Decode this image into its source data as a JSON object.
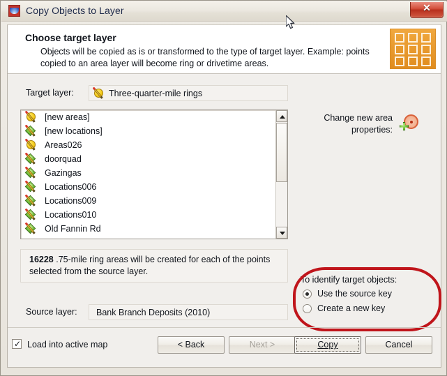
{
  "window": {
    "title": "Copy Objects to Layer",
    "app_icon": "app-window-icon",
    "close_label": "✕"
  },
  "header": {
    "title": "Choose target layer",
    "description": "Objects will be copied as is or transformed to the type of target layer. Example: points copied to an area layer will become ring or drivetime areas.",
    "icon": "grid-of-squares-icon"
  },
  "target": {
    "label": "Target layer:",
    "value": "Three-quarter-mile rings",
    "icon": "area-layer-icon"
  },
  "layer_list": {
    "items": [
      {
        "label": "[new areas]",
        "icon": "area-layer-icon"
      },
      {
        "label": "[new locations]",
        "icon": "point-layer-icon"
      },
      {
        "label": "Areas026",
        "icon": "area-layer-icon"
      },
      {
        "label": "doorquad",
        "icon": "point-layer-icon"
      },
      {
        "label": "Gazingas",
        "icon": "point-layer-icon"
      },
      {
        "label": "Locations006",
        "icon": "point-layer-icon"
      },
      {
        "label": "Locations009",
        "icon": "point-layer-icon"
      },
      {
        "label": "Locations010",
        "icon": "point-layer-icon"
      },
      {
        "label": "Old Fannin Rd",
        "icon": "point-layer-icon"
      }
    ],
    "scroll_up_icon": "triangle-up-icon",
    "scroll_down_icon": "triangle-down-icon"
  },
  "info": {
    "count": "16228",
    "text": " .75-mile ring areas will be created for each of the points selected from the source layer."
  },
  "source": {
    "label": "Source layer:",
    "value": "Bank Branch Deposits (2010)"
  },
  "change_properties": {
    "label": "Change new area properties:",
    "icon": "ring-area-properties-icon"
  },
  "identify": {
    "title": "To identify target objects:",
    "options": [
      {
        "label": "Use the source key",
        "selected": true
      },
      {
        "label": "Create a new key",
        "selected": false
      }
    ]
  },
  "footer": {
    "load_into_active_map": {
      "label": "Load into active map",
      "checked": true,
      "tick": "✓"
    },
    "buttons": {
      "back": "< Back",
      "next": "Next >",
      "copy": "Copy",
      "cancel": "Cancel"
    }
  },
  "annotation": {
    "highlight_color": "#c0151b"
  }
}
